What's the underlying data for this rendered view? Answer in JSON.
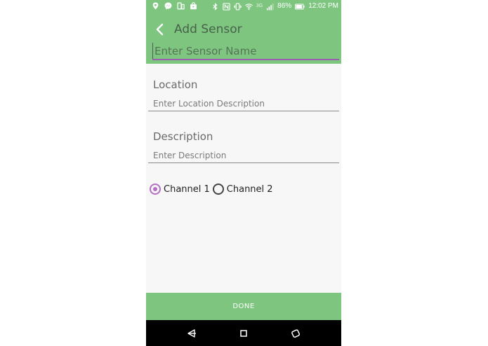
{
  "status_bar": {
    "network": "3G",
    "battery": "86%",
    "time": "12:02 PM"
  },
  "app_bar": {
    "title": "Add Sensor",
    "name_placeholder": "Enter Sensor Name"
  },
  "form": {
    "location_label": "Location",
    "location_placeholder": "Enter Location Description",
    "description_label": "Description",
    "description_placeholder": "Enter Description"
  },
  "channels": [
    {
      "label": "Channel 1",
      "selected": true
    },
    {
      "label": "Channel 2",
      "selected": false
    }
  ],
  "done_label": "DONE",
  "colors": {
    "primary": "#7ec680",
    "accent": "#b46fc4",
    "background": "#f7f7f7",
    "nav": "#000000"
  },
  "icons": {
    "back": "chevron-left-icon",
    "nav_back": "nav-back-icon",
    "nav_home": "nav-home-icon",
    "nav_recents": "nav-recents-icon"
  }
}
